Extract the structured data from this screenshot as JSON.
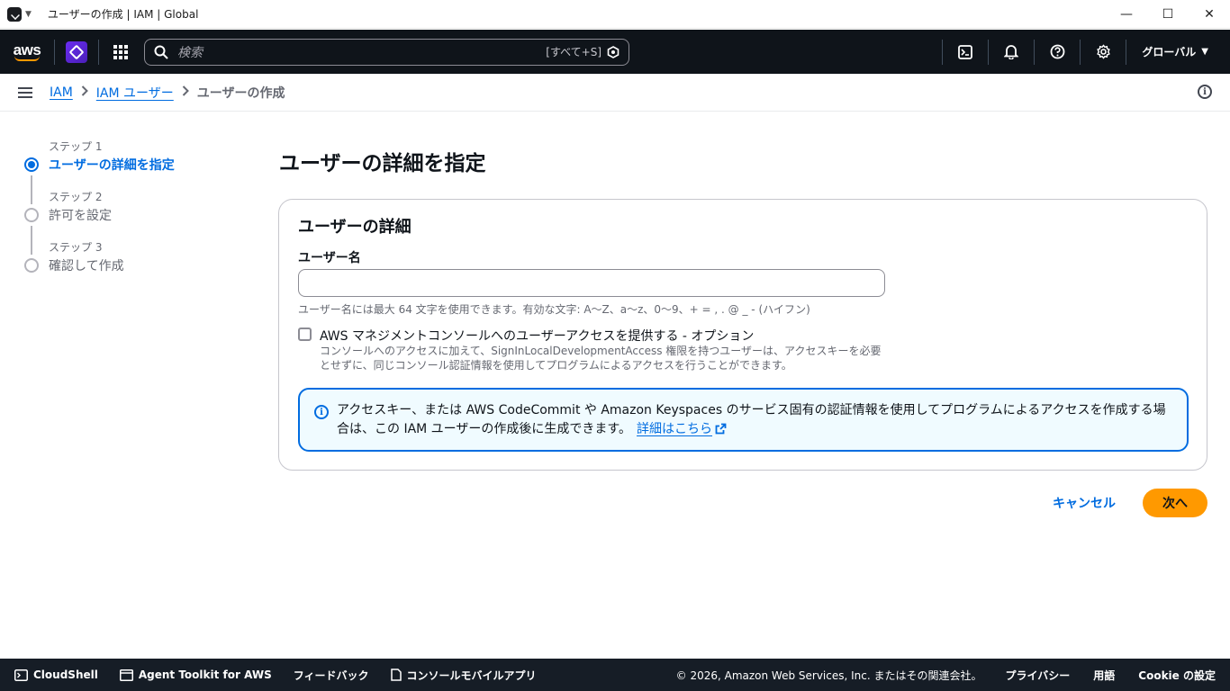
{
  "browser": {
    "title": "ユーザーの作成 | IAM | Global",
    "controls": {
      "minimize": "—",
      "maximize": "☐",
      "close": "✕"
    }
  },
  "topnav": {
    "logo": "aws",
    "search_placeholder": "検索",
    "search_shortcut": "[すべて+S]",
    "region": "グローバル",
    "icons": [
      "cloudshell-icon",
      "bell-icon",
      "help-icon",
      "settings-icon"
    ]
  },
  "breadcrumb": {
    "items": [
      "IAM",
      "IAM ユーザー"
    ],
    "current": "ユーザーの作成"
  },
  "steps": [
    {
      "label": "ステップ 1",
      "name": "ユーザーの詳細を指定",
      "active": true
    },
    {
      "label": "ステップ 2",
      "name": "許可を設定",
      "active": false
    },
    {
      "label": "ステップ 3",
      "name": "確認して作成",
      "active": false
    }
  ],
  "main": {
    "title": "ユーザーの詳細を指定",
    "card_title": "ユーザーの詳細",
    "username_label": "ユーザー名",
    "username_value": "",
    "username_hint": "ユーザー名には最大 64 文字を使用できます。有効な文字: A〜Z、a〜z、0〜9、+ = , . @ _ - (ハイフン)",
    "console_access_label": "AWS マネジメントコンソールへのユーザーアクセスを提供する - オプション",
    "console_access_checked": false,
    "console_access_desc": "コンソールへのアクセスに加えて、SignInLocalDevelopmentAccess 権限を持つユーザーは、アクセスキーを必要とせずに、同じコンソール認証情報を使用してプログラムによるアクセスを行うことができます。",
    "alert_text": "アクセスキー、または AWS CodeCommit や Amazon Keyspaces のサービス固有の認証情報を使用してプログラムによるアクセスを作成する場合は、この IAM ユーザーの作成後に生成できます。",
    "alert_link": "詳細はこちら",
    "cancel_label": "キャンセル",
    "next_label": "次へ"
  },
  "footer": {
    "cloudshell": "CloudShell",
    "agent_toolkit": "Agent Toolkit for AWS",
    "feedback": "フィードバック",
    "mobile_app": "コンソールモバイルアプリ",
    "copyright": "© 2026, Amazon Web Services, Inc. またはその関連会社。",
    "privacy": "プライバシー",
    "terms": "用語",
    "cookie": "Cookie の設定"
  },
  "colors": {
    "accent": "#006ce0",
    "primary_button": "#ff9900",
    "nav_bg": "#0f141a",
    "footer_bg": "#161d26"
  }
}
